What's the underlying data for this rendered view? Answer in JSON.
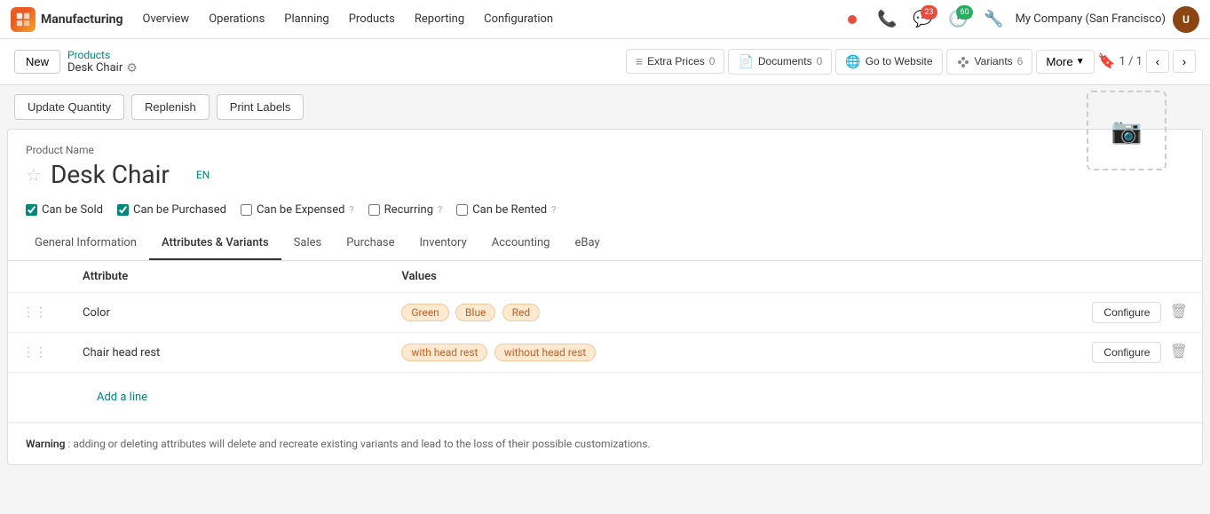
{
  "app": {
    "logo_text": "Manufacturing"
  },
  "topnav": {
    "items": [
      {
        "label": "Overview",
        "active": false
      },
      {
        "label": "Operations",
        "active": false
      },
      {
        "label": "Planning",
        "active": false
      },
      {
        "label": "Products",
        "active": false
      },
      {
        "label": "Reporting",
        "active": false
      },
      {
        "label": "Configuration",
        "active": false
      }
    ],
    "company": "My Company (San Francisco)",
    "notification_count": "23",
    "activity_count": "60"
  },
  "toolbar": {
    "new_label": "New",
    "breadcrumb_parent": "Products",
    "breadcrumb_current": "Desk Chair",
    "actions": [
      {
        "label": "Extra Prices",
        "count": "0",
        "icon": "list"
      },
      {
        "label": "Documents",
        "count": "0",
        "icon": "file"
      },
      {
        "label": "Go to Website",
        "count": "",
        "icon": "globe"
      },
      {
        "label": "Variants",
        "count": "6",
        "icon": "variants"
      }
    ],
    "more_label": "More",
    "pager": "1 / 1"
  },
  "action_buttons": [
    {
      "label": "Update Quantity"
    },
    {
      "label": "Replenish"
    },
    {
      "label": "Print Labels"
    }
  ],
  "product": {
    "name_label": "Product Name",
    "name": "Desk Chair",
    "lang": "EN",
    "checkboxes": [
      {
        "label": "Can be Sold",
        "checked": true,
        "has_help": false
      },
      {
        "label": "Can be Purchased",
        "checked": true,
        "has_help": false
      },
      {
        "label": "Can be Expensed",
        "checked": false,
        "has_help": true
      },
      {
        "label": "Recurring",
        "checked": false,
        "has_help": true
      },
      {
        "label": "Can be Rented",
        "checked": false,
        "has_help": true
      }
    ]
  },
  "tabs": [
    {
      "label": "General Information",
      "active": false
    },
    {
      "label": "Attributes & Variants",
      "active": true
    },
    {
      "label": "Sales",
      "active": false
    },
    {
      "label": "Purchase",
      "active": false
    },
    {
      "label": "Inventory",
      "active": false
    },
    {
      "label": "Accounting",
      "active": false
    },
    {
      "label": "eBay",
      "active": false
    }
  ],
  "table": {
    "headers": [
      "Attribute",
      "Values"
    ],
    "rows": [
      {
        "attribute": "Color",
        "values": [
          "Green",
          "Blue",
          "Red"
        ]
      },
      {
        "attribute": "Chair head rest",
        "values": [
          "with head rest",
          "without head rest"
        ]
      }
    ],
    "add_line_label": "Add a line"
  },
  "warning": {
    "bold": "Warning",
    "text": ": adding or deleting attributes will delete and recreate existing variants and lead to the loss of their possible customizations."
  },
  "configure_label": "Configure"
}
